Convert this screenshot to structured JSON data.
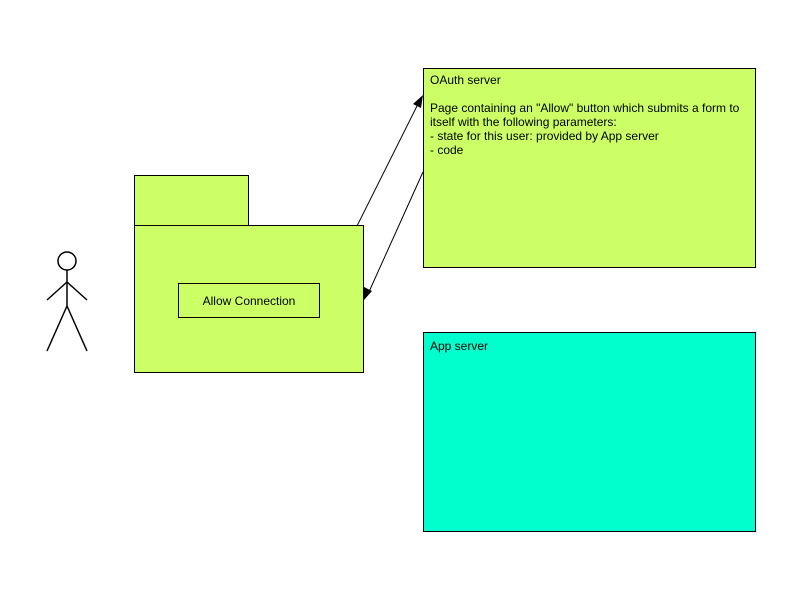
{
  "actor": {
    "icon": "stick-figure-icon"
  },
  "package": {
    "button_label": "Allow Connection"
  },
  "oauth_server": {
    "title": "OAuth server",
    "description": "Page containing an \"Allow\" button which submits a form to itself with the following parameters:",
    "params": [
      "- state for this user: provided by App server",
      "- code"
    ]
  },
  "app_server": {
    "title": "App server"
  },
  "colors": {
    "package_fill": "#ccff66",
    "oauth_fill": "#ccff66",
    "app_fill": "#00ffcc",
    "stroke": "#000000"
  }
}
